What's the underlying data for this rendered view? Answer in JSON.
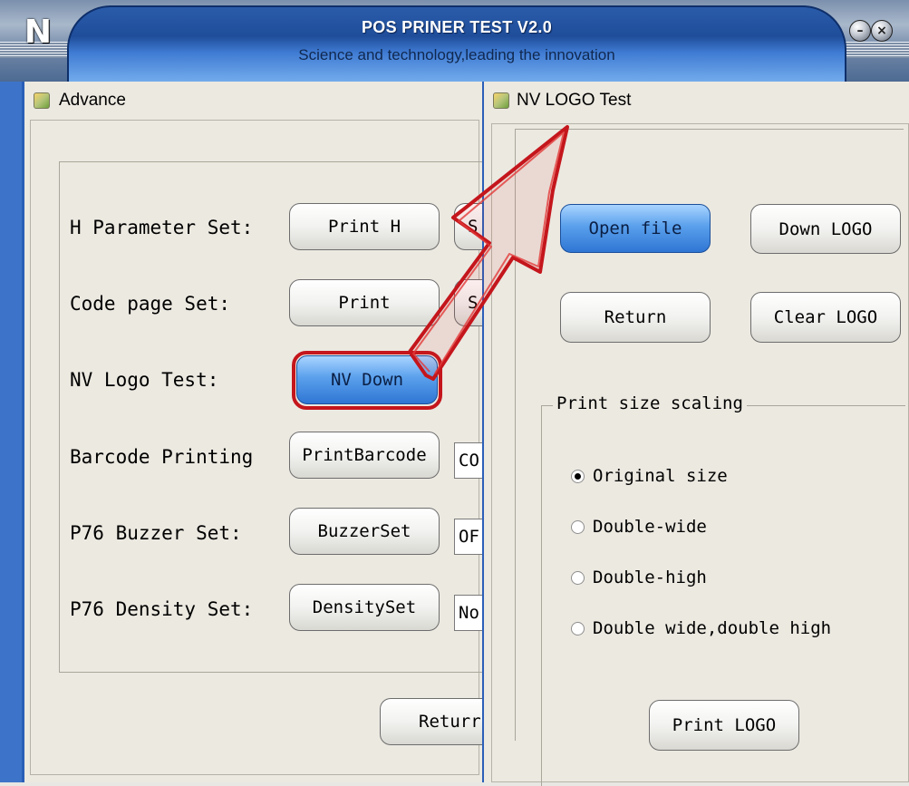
{
  "app": {
    "logo": "N",
    "title": "POS PRINER TEST V2.0",
    "subtitle": "Science and technology,leading the innovation",
    "minimize_glyph": "–",
    "close_glyph": "×"
  },
  "advance": {
    "title": "Advance",
    "rows": [
      {
        "label": "H Parameter Set:",
        "button": "Print H",
        "extra_button": "S"
      },
      {
        "label": "Code page Set:",
        "button": "Print",
        "extra_button": "S"
      },
      {
        "label": "NV Logo Test:",
        "button": "NV Down"
      },
      {
        "label": "Barcode Printing",
        "button": "PrintBarcode",
        "combo_value": "CO"
      },
      {
        "label": "P76 Buzzer Set:",
        "button": "BuzzerSet",
        "combo_value": "OF"
      },
      {
        "label": "P76 Density Set:",
        "button": "DensitySet",
        "combo_value": "No"
      }
    ],
    "return_button": "Returr"
  },
  "nv_logo": {
    "title": "NV LOGO Test",
    "open_file": "Open file",
    "down_logo": "Down LOGO",
    "return": "Return",
    "clear_logo": "Clear LOGO",
    "scaling_legend": "Print size scaling",
    "options": [
      {
        "label": "Original size",
        "checked": true
      },
      {
        "label": "Double-wide",
        "checked": false
      },
      {
        "label": "Double-high",
        "checked": false
      },
      {
        "label": "Double wide,double high",
        "checked": false
      }
    ],
    "print_logo": "Print LOGO"
  },
  "colors": {
    "frame_blue": "#3d74c9",
    "highlight_red": "#c4161c",
    "active_button_blue": "#2f76d4"
  }
}
